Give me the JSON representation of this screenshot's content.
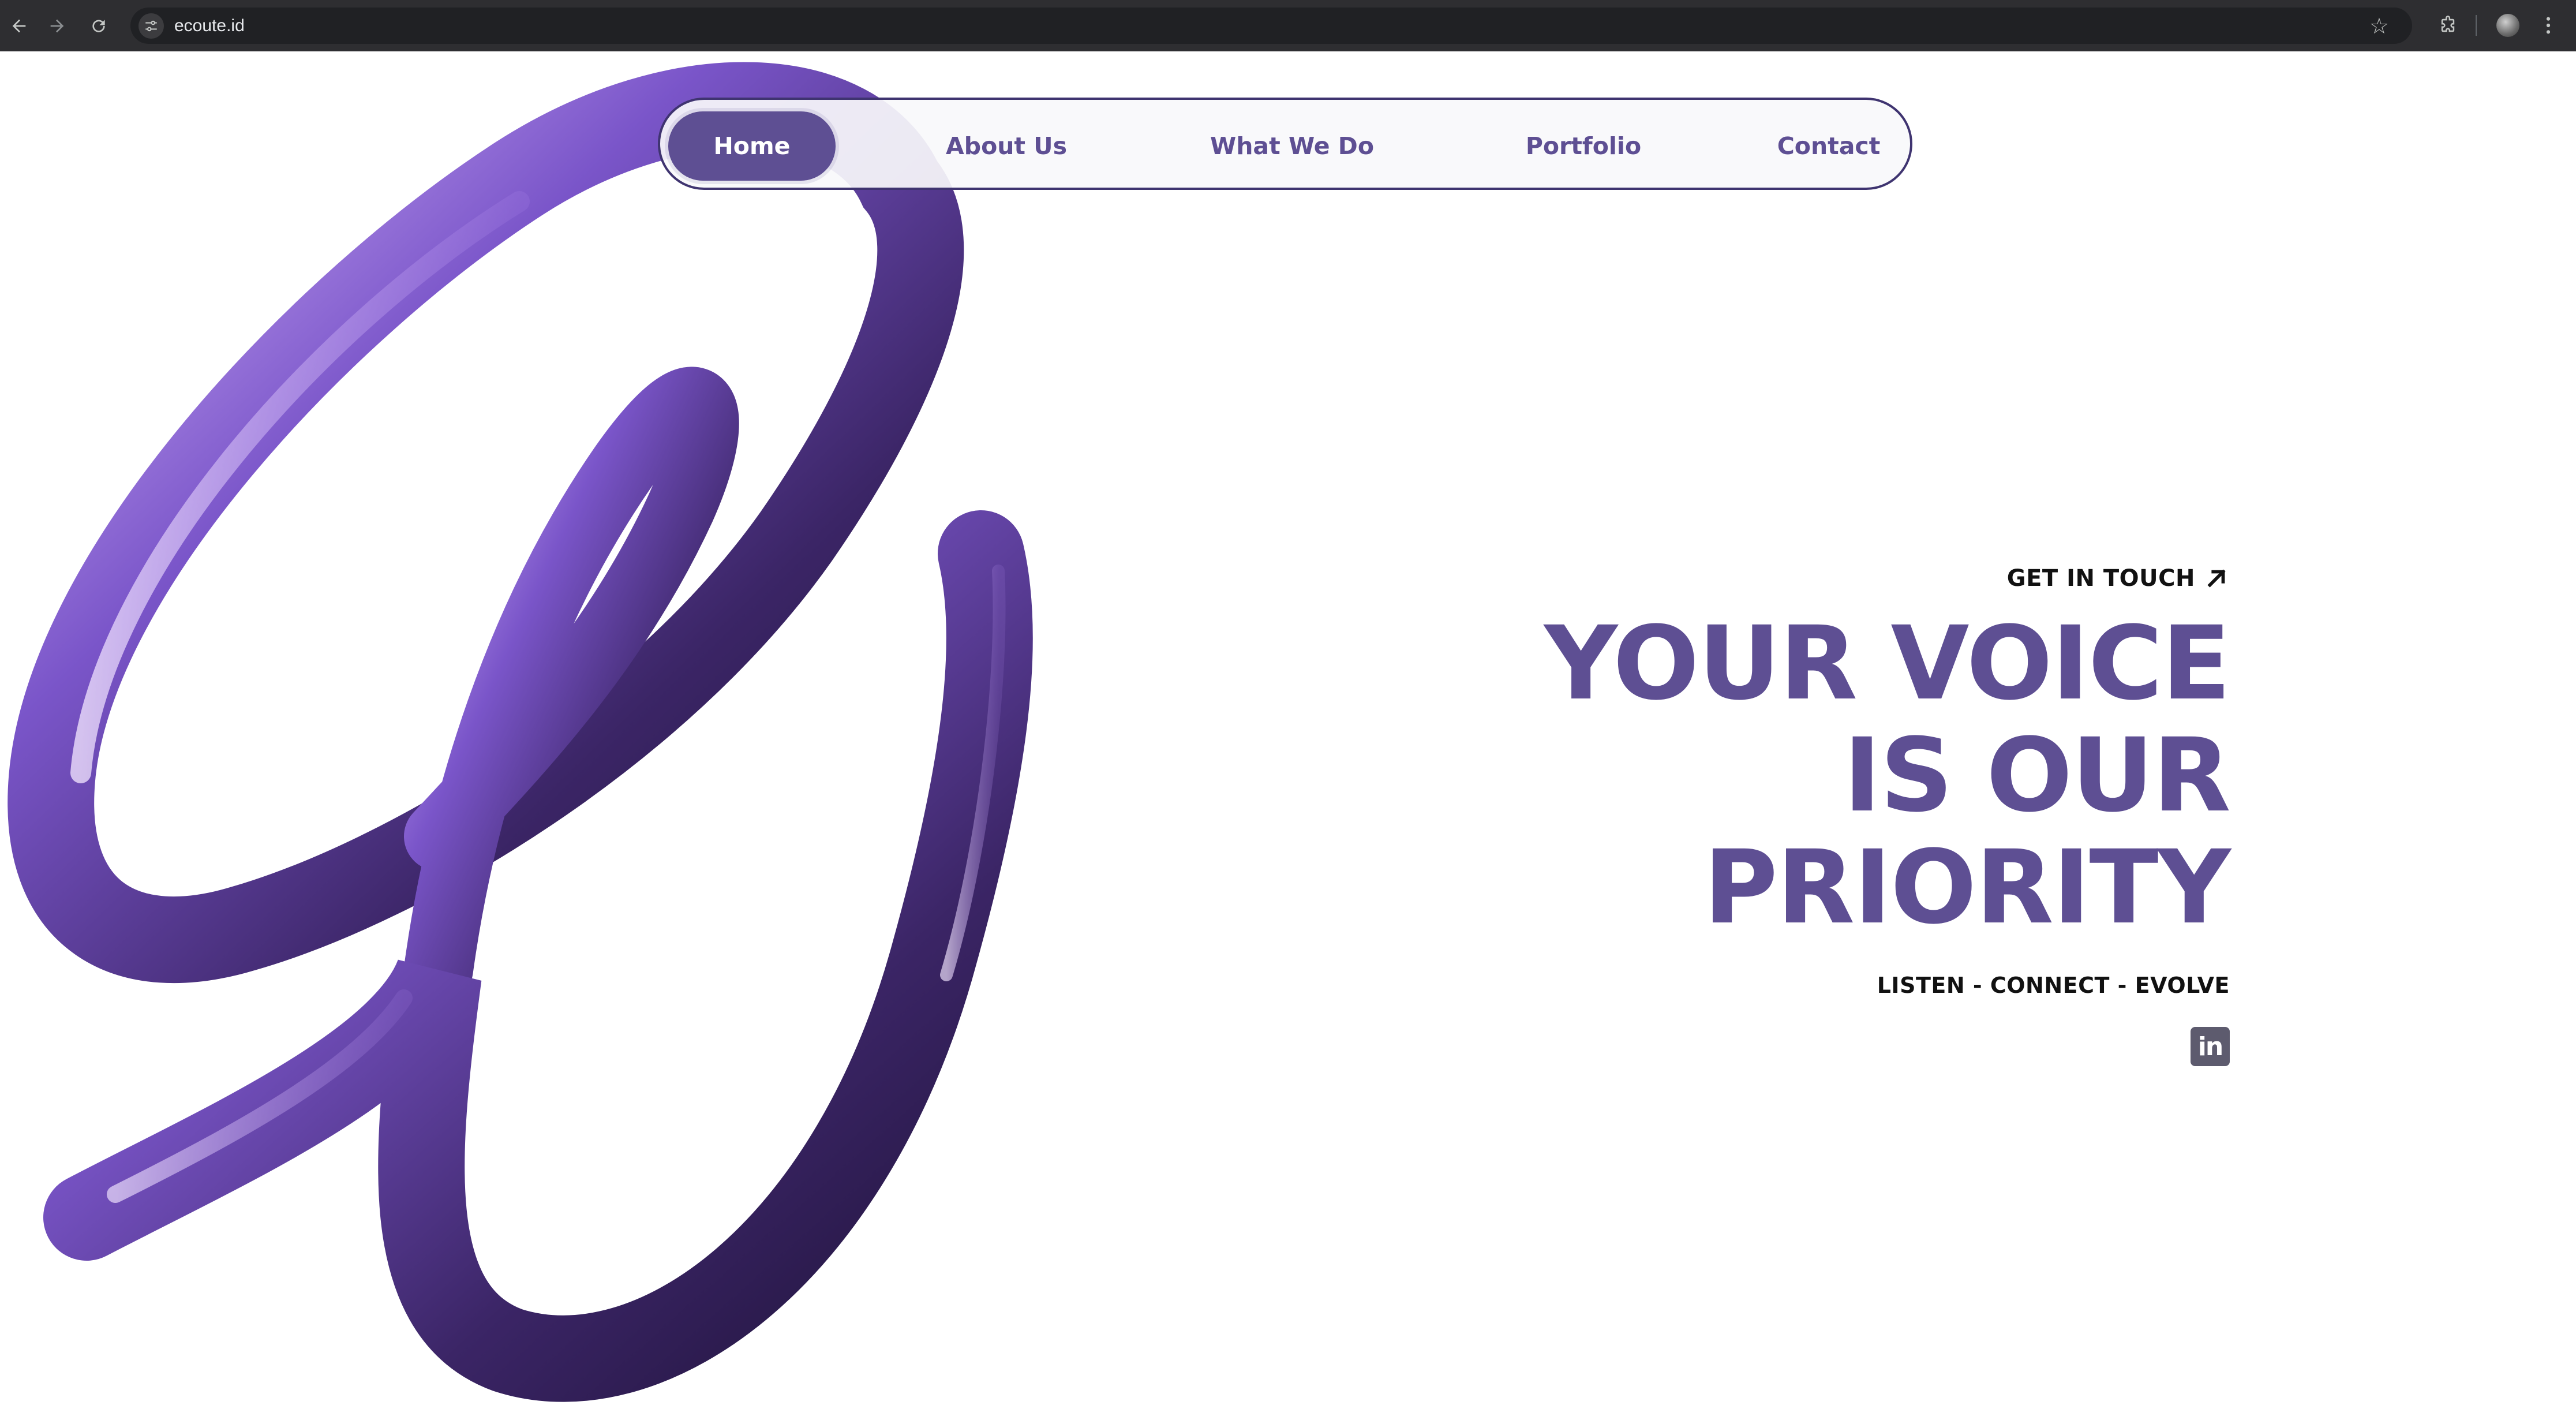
{
  "browser": {
    "url": "ecoute.id",
    "icons": [
      "back-icon",
      "forward-icon",
      "reload-icon",
      "site-info-icon",
      "bookmark-star-icon",
      "extensions-icon",
      "profile-avatar",
      "menu-icon"
    ]
  },
  "nav": {
    "items": [
      {
        "label": "Home",
        "active": true
      },
      {
        "label": "About Us",
        "active": false
      },
      {
        "label": "What We Do",
        "active": false
      },
      {
        "label": "Portfolio",
        "active": false
      },
      {
        "label": "Contact",
        "active": false
      }
    ]
  },
  "hero": {
    "cta_label": "GET IN TOUCH",
    "headline_lines": [
      "YOUR VOICE",
      "IS OUR",
      "PRIORITY"
    ],
    "tagline": "LISTEN - CONNECT - EVOLVE",
    "social_icon": "linkedin-icon",
    "social_text": "in"
  },
  "colors": {
    "brand_purple": "#5E4F93",
    "nav_border": "#3f3470",
    "text_dark": "#111111"
  }
}
